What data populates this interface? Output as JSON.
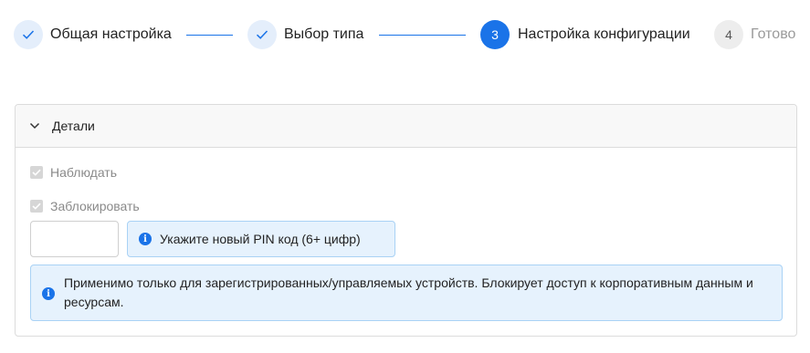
{
  "stepper": {
    "steps": [
      {
        "label": "Общая настройка",
        "state": "done",
        "number": ""
      },
      {
        "label": "Выбор типа",
        "state": "done",
        "number": ""
      },
      {
        "label": "Настройка конфигурации",
        "state": "active",
        "number": "3"
      },
      {
        "label": "Готово",
        "state": "pending",
        "number": "4"
      }
    ]
  },
  "panel": {
    "title": "Детали",
    "expanded": true,
    "checkboxes": [
      {
        "label": "Наблюдать",
        "checked": true,
        "disabled": true
      },
      {
        "label": "Заблокировать",
        "checked": true,
        "disabled": true
      }
    ],
    "pin_input_value": "",
    "pin_hint": "Укажите новый PIN код (6+ цифр)",
    "note": "Применимо только для зарегистрированных/управляемых устройств. Блокирует доступ к корпоративным данным и ресурсам."
  },
  "colors": {
    "accent": "#1a73e8",
    "info_bg": "#e6f2fd",
    "info_border": "#a9d2f5",
    "done_circle_bg": "#e4eefb"
  },
  "icons": {
    "step_done": "check-icon",
    "panel_toggle": "chevron-down-icon",
    "info": "info-icon"
  }
}
